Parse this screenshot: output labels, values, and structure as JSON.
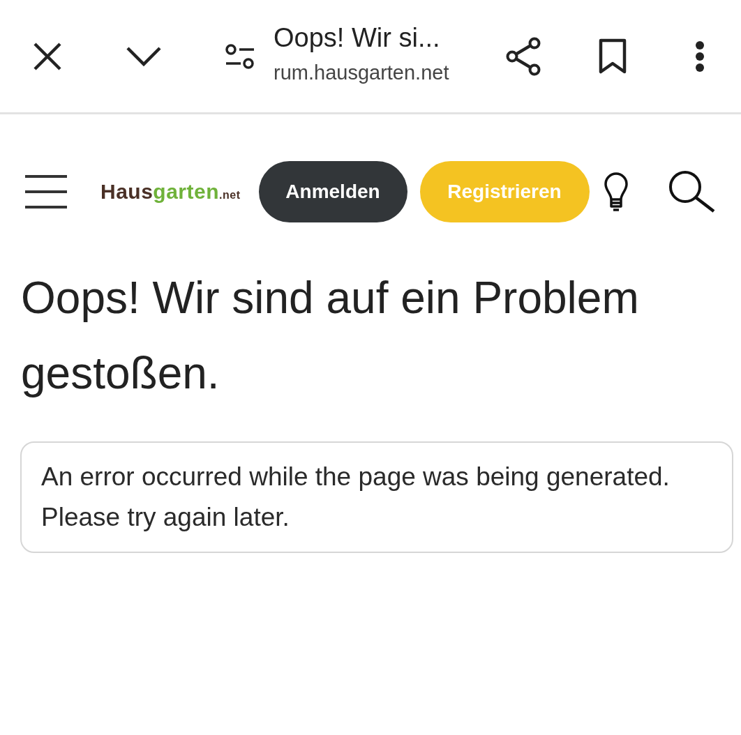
{
  "browser_bar": {
    "title": "Oops! Wir si...",
    "url": "rum.hausgarten.net"
  },
  "site_header": {
    "logo": {
      "first": "Haus",
      "second": "garten",
      "suffix": ".net"
    },
    "buttons": [
      {
        "label": "Anmelden",
        "kind": "dark"
      },
      {
        "label": "Registrieren",
        "kind": "accent"
      }
    ]
  },
  "heading": "Oops! Wir sind auf ein Problem gestoßen.",
  "error_message": "An error occurred while the page was being generated. Please try again later."
}
